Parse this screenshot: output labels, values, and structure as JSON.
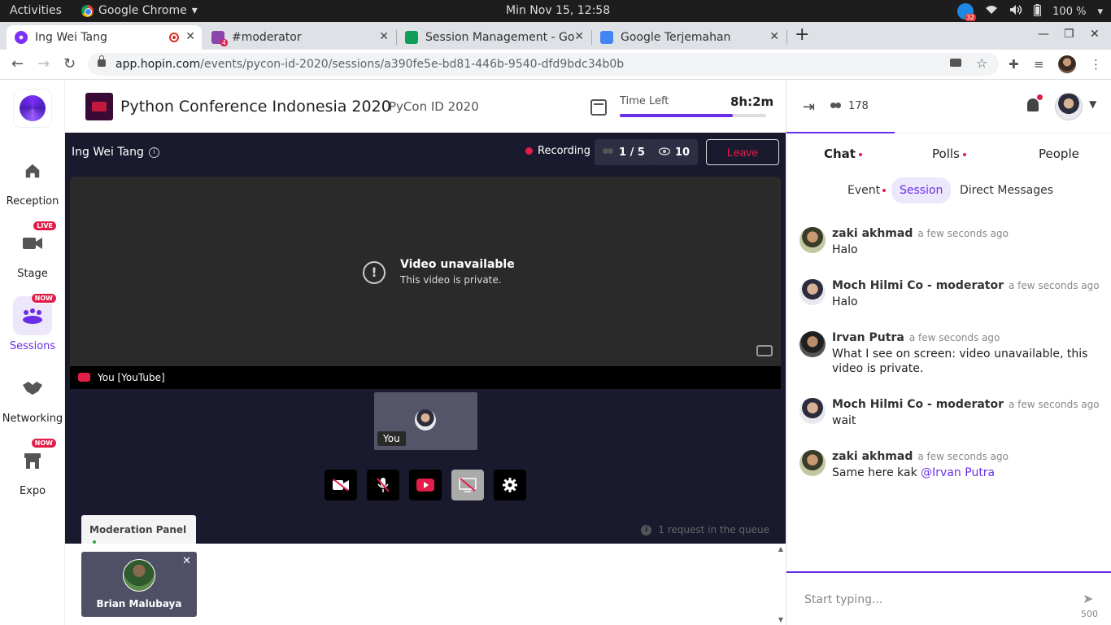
{
  "system": {
    "activities": "Activities",
    "app_name": "Google Chrome",
    "clock": "Min Nov 15, 12:58",
    "notif_count": "32",
    "battery": "100 %"
  },
  "browser": {
    "tabs": [
      {
        "title": "Ing Wei Tang",
        "favicon_color": "#7b2ff7"
      },
      {
        "title": "#moderator",
        "favicon_color": "#8e44ad",
        "badge": "4"
      },
      {
        "title": "Session Management - Go",
        "favicon_color": "#0f9d58"
      },
      {
        "title": "Google Terjemahan",
        "favicon_color": "#4285f4"
      }
    ],
    "url_host": "app.hopin.com",
    "url_path": "/events/pycon-id-2020/sessions/a390fe5e-bd81-446b-9540-dfd9bdc34b0b"
  },
  "leftnav": {
    "items": [
      {
        "label": "Reception",
        "icon": "home-icon"
      },
      {
        "label": "Stage",
        "icon": "video-camera-icon",
        "badge": "LIVE"
      },
      {
        "label": "Sessions",
        "icon": "group-icon",
        "badge": "NOW",
        "active": true
      },
      {
        "label": "Networking",
        "icon": "handshake-icon"
      },
      {
        "label": "Expo",
        "icon": "booth-icon",
        "badge": "NOW"
      }
    ]
  },
  "event": {
    "title": "Python Conference Indonesia 2020",
    "subtitle": "PyCon ID 2020",
    "time_left_label": "Time Left",
    "time_left_value": "8h:2m",
    "time_left_progress": 0.77
  },
  "stage": {
    "session_name": "Ing Wei Tang",
    "recording_label": "Recording",
    "participants": "1 / 5",
    "viewers": "10",
    "leave_label": "Leave",
    "video_title": "Video unavailable",
    "video_subtitle": "This video is private.",
    "stream_label": "You [YouTube]",
    "self_tag": "You",
    "moderation_tab": "Moderation Panel",
    "queue_text": "1 request in the queue",
    "request_name": "Brian Malubaya"
  },
  "chat": {
    "attendee_count": "178",
    "tabs": [
      "Chat",
      "Polls",
      "People"
    ],
    "subtabs": [
      "Event",
      "Session",
      "Direct Messages"
    ],
    "messages": [
      {
        "author": "zaki akhmad",
        "time": "a few seconds ago",
        "text": "Halo"
      },
      {
        "author": "Moch Hilmi Co - moderator",
        "time": "a few seconds ago",
        "text": "Halo"
      },
      {
        "author": "Irvan Putra",
        "time": "a few seconds ago",
        "text": "What I see on screen: video unavailable, this video is private."
      },
      {
        "author": "Moch Hilmi Co - moderator",
        "time": "a few seconds ago",
        "text": "wait"
      },
      {
        "author": "zaki akhmad",
        "time": "a few seconds ago",
        "text": "Same here kak ",
        "mention": "@Irvan Putra"
      }
    ],
    "placeholder": "Start typing...",
    "char_count": "500"
  },
  "colors": {
    "accent": "#6b2ee8",
    "live_red": "#e21d48",
    "stage_bg": "#1a1a2e"
  }
}
